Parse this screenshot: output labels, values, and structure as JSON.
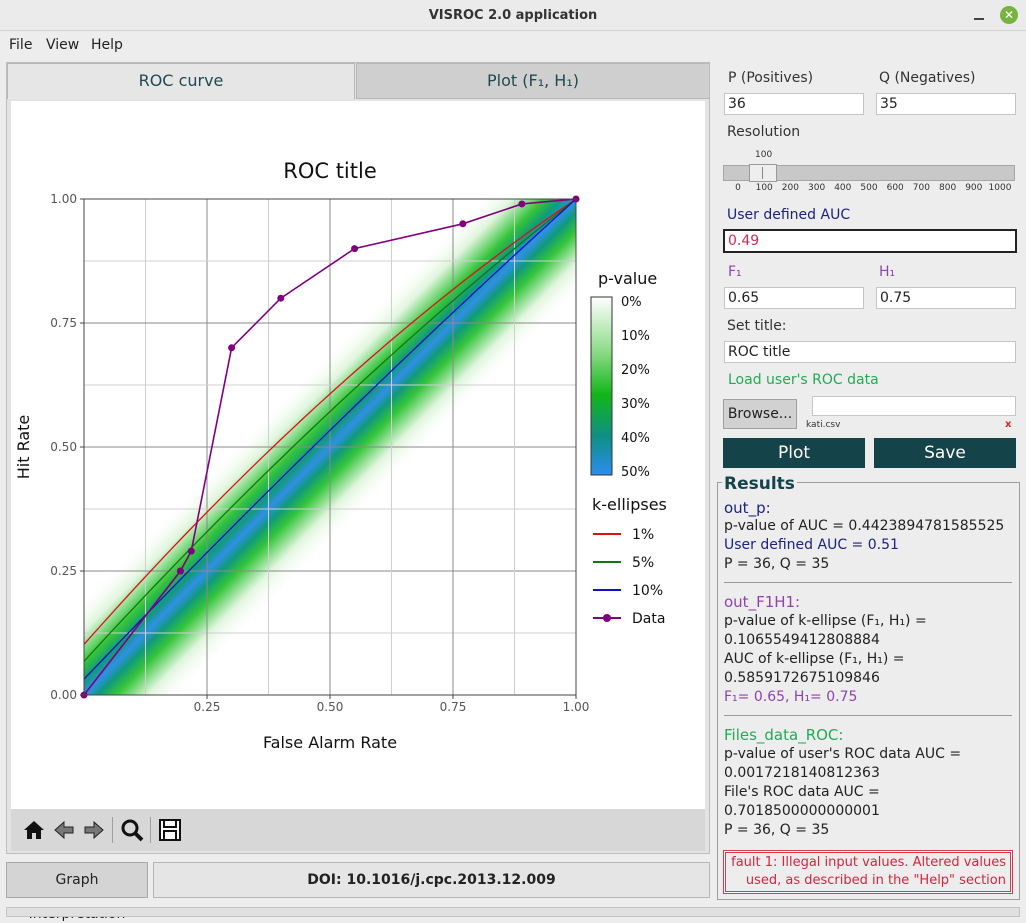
{
  "window": {
    "title": "VISROC 2.0 application"
  },
  "menu": [
    "File",
    "View",
    "Help"
  ],
  "tabs": {
    "roc": "ROC curve",
    "plot": "Plot (F₁, H₁)"
  },
  "plot": {
    "colorbar_title": "p-value",
    "colorbar_ticks": [
      "0%",
      "10%",
      "20%",
      "30%",
      "40%",
      "50%"
    ],
    "ellipse_legend_title": "k-ellipses"
  },
  "chart_data": {
    "type": "line",
    "title": "ROC title",
    "xlabel": "False Alarm Rate",
    "ylabel": "Hit Rate",
    "xlim": [
      0,
      1
    ],
    "ylim": [
      0,
      1
    ],
    "xticks": [
      "0.25",
      "0.50",
      "0.75",
      "1.00"
    ],
    "yticks": [
      "0.00",
      "0.25",
      "0.50",
      "0.75",
      "1.00"
    ],
    "grid": true,
    "series": [
      {
        "name": "1%",
        "color": "#dd1111",
        "kind": "ellipse",
        "offset": 0.102
      },
      {
        "name": "5%",
        "color": "#117711",
        "kind": "ellipse",
        "offset": 0.068
      },
      {
        "name": "10%",
        "color": "#1111cc",
        "kind": "ellipse",
        "offset": 0.032
      },
      {
        "name": "Data",
        "color": "#800080",
        "kind": "data",
        "x": [
          0,
          0.196,
          0.218,
          0.3,
          0.4,
          0.55,
          0.77,
          0.89,
          1.0
        ],
        "y": [
          0,
          0.25,
          0.29,
          0.7,
          0.8,
          0.9,
          0.95,
          0.99,
          1.0
        ]
      }
    ]
  },
  "toolbar_icons": [
    "home-icon",
    "back-arrow-icon",
    "forward-arrow-icon",
    "zoom-icon",
    "save-icon"
  ],
  "bottom": {
    "graph_button": "Graph Interpretation",
    "doi": "DOI: 10.1016/j.cpc.2013.12.009"
  },
  "form": {
    "p_label": "P (Positives)",
    "q_label": "Q (Negatives)",
    "p_value": "36",
    "q_value": "35",
    "resolution_label": "Resolution",
    "resolution_value": "100",
    "resolution_ticks": [
      "0",
      "100",
      "200",
      "300",
      "400",
      "500",
      "600",
      "700",
      "800",
      "900",
      "1000"
    ],
    "auc_label": "User defined AUC",
    "auc_value": "0.49",
    "f1_label": "F₁",
    "h1_label": "H₁",
    "f1_value": "0.65",
    "h1_value": "0.75",
    "title_label": "Set title:",
    "title_value": "ROC title",
    "load_label": "Load user's ROC data",
    "browse_button": "Browse...",
    "file_path": "",
    "file_name": "kati.csv",
    "clear_x": "x",
    "plot_button": "Plot",
    "save_button": "Save"
  },
  "results": {
    "heading": "Results",
    "out_p": {
      "title": "out_p:",
      "line1": "p-value of AUC = 0.4423894781585525",
      "line2": "User defined AUC = 0.51",
      "line3": "P = 36, Q = 35"
    },
    "out_f1h1": {
      "title": "out_F1H1:",
      "line1": "p-value of k-ellipse (F₁, H₁) =",
      "line2": "0.1065549412808884",
      "line3": "AUC of k-ellipse (F₁, H₁) =",
      "line4": "0.5859172675109846",
      "line5": "F₁= 0.65, H₁= 0.75"
    },
    "files": {
      "title": "Files_data_ROC:",
      "line1": "p-value of user's ROC data AUC =",
      "line2": "0.0017218140812363",
      "line3": "File's ROC data AUC =",
      "line4": "0.7018500000000001",
      "line5": "P = 36, Q = 35"
    },
    "fault_line1": "fault 1:    Illegal input values. Altered values",
    "fault_line2": "used, as described in the \"Help\" section"
  },
  "colors": {
    "accent_dark": "#15434a",
    "data_purple": "#800080",
    "fault_red": "#d62440",
    "load_green": "#22aa55",
    "auc_blue": "#1a237e"
  }
}
